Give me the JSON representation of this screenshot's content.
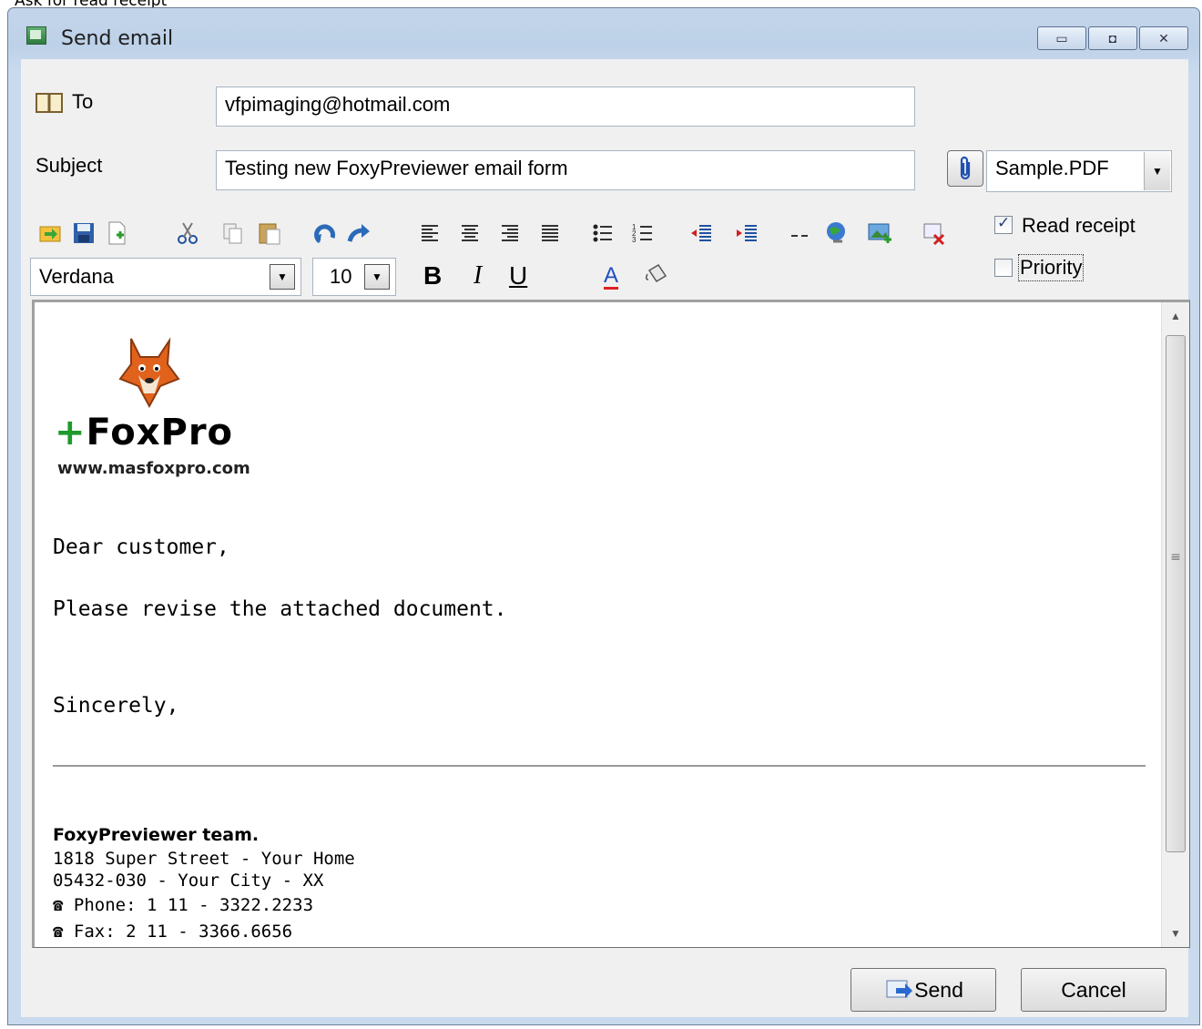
{
  "top_caption": "Ask for read receipt",
  "window": {
    "title": "Send email",
    "caption_buttons": {
      "minimize": "▭",
      "restore": "◘",
      "close": "✕"
    }
  },
  "to": {
    "label": "To",
    "value": "vfpimaging@hotmail.com"
  },
  "subject": {
    "label": "Subject",
    "value": "Testing new FoxyPreviewer email form"
  },
  "attachment": {
    "selected": "Sample.PDF"
  },
  "toolbar": {
    "icons": [
      "open-icon",
      "save-icon",
      "new-icon",
      "cut-icon",
      "copy-icon",
      "paste-icon",
      "undo-icon",
      "redo-icon",
      "align-left-icon",
      "align-center-icon",
      "align-right-icon",
      "justify-icon",
      "bullet-list-icon",
      "numbered-list-icon",
      "outdent-icon",
      "indent-icon",
      "horizontal-rule-icon",
      "hyperlink-icon",
      "insert-image-icon",
      "remove-format-icon"
    ]
  },
  "font": {
    "name": "Verdana",
    "size": "10"
  },
  "format": {
    "bold": "B",
    "italic": "I",
    "underline": "U",
    "font_color": "A"
  },
  "options": {
    "read_receipt": {
      "label": "Read receipt",
      "checked": true
    },
    "priority": {
      "label": "Priority",
      "checked": false
    }
  },
  "message": {
    "logo_name": "+FoxPro",
    "logo_plus": "+",
    "logo_word": "FoxPro",
    "logo_url": "www.masfoxpro.com",
    "greeting": "Dear customer,",
    "line1": "Please revise the attached document.",
    "closing": "Sincerely,",
    "signature": {
      "team": "FoxyPreviewer team.",
      "address1": "1818 Super Street  -  Your Home",
      "address2": "05432-030  -  Your City -  XX",
      "phone": "Phone: 1 11 - 3322.2233",
      "fax": "Fax:  2 11 - 3366.6656"
    }
  },
  "buttons": {
    "send": "Send",
    "cancel": "Cancel"
  },
  "colors": {
    "accent": "#1f9a2c",
    "font_color_underline": "#e02020"
  }
}
